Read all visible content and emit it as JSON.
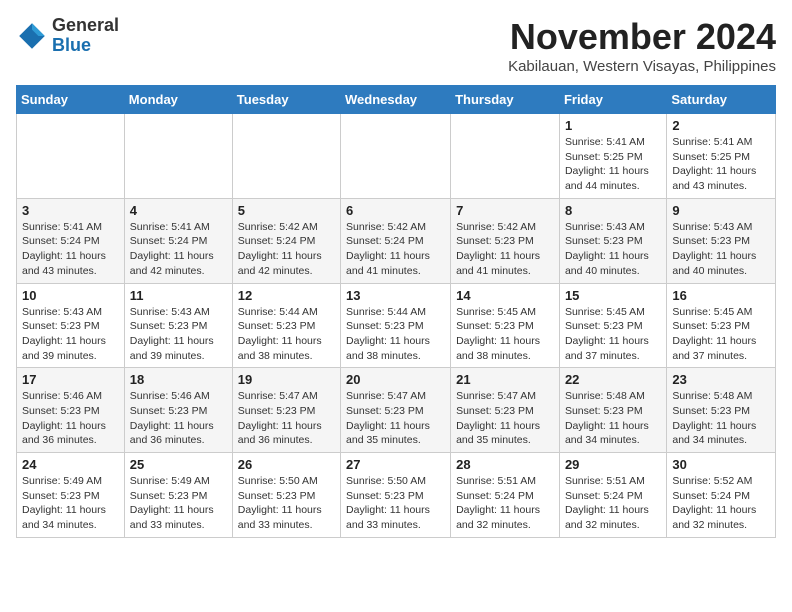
{
  "header": {
    "logo_line1": "General",
    "logo_line2": "Blue",
    "month_title": "November 2024",
    "location": "Kabilauan, Western Visayas, Philippines"
  },
  "weekdays": [
    "Sunday",
    "Monday",
    "Tuesday",
    "Wednesday",
    "Thursday",
    "Friday",
    "Saturday"
  ],
  "weeks": [
    [
      {
        "day": "",
        "info": ""
      },
      {
        "day": "",
        "info": ""
      },
      {
        "day": "",
        "info": ""
      },
      {
        "day": "",
        "info": ""
      },
      {
        "day": "",
        "info": ""
      },
      {
        "day": "1",
        "info": "Sunrise: 5:41 AM\nSunset: 5:25 PM\nDaylight: 11 hours and 44 minutes."
      },
      {
        "day": "2",
        "info": "Sunrise: 5:41 AM\nSunset: 5:25 PM\nDaylight: 11 hours and 43 minutes."
      }
    ],
    [
      {
        "day": "3",
        "info": "Sunrise: 5:41 AM\nSunset: 5:24 PM\nDaylight: 11 hours and 43 minutes."
      },
      {
        "day": "4",
        "info": "Sunrise: 5:41 AM\nSunset: 5:24 PM\nDaylight: 11 hours and 42 minutes."
      },
      {
        "day": "5",
        "info": "Sunrise: 5:42 AM\nSunset: 5:24 PM\nDaylight: 11 hours and 42 minutes."
      },
      {
        "day": "6",
        "info": "Sunrise: 5:42 AM\nSunset: 5:24 PM\nDaylight: 11 hours and 41 minutes."
      },
      {
        "day": "7",
        "info": "Sunrise: 5:42 AM\nSunset: 5:23 PM\nDaylight: 11 hours and 41 minutes."
      },
      {
        "day": "8",
        "info": "Sunrise: 5:43 AM\nSunset: 5:23 PM\nDaylight: 11 hours and 40 minutes."
      },
      {
        "day": "9",
        "info": "Sunrise: 5:43 AM\nSunset: 5:23 PM\nDaylight: 11 hours and 40 minutes."
      }
    ],
    [
      {
        "day": "10",
        "info": "Sunrise: 5:43 AM\nSunset: 5:23 PM\nDaylight: 11 hours and 39 minutes."
      },
      {
        "day": "11",
        "info": "Sunrise: 5:43 AM\nSunset: 5:23 PM\nDaylight: 11 hours and 39 minutes."
      },
      {
        "day": "12",
        "info": "Sunrise: 5:44 AM\nSunset: 5:23 PM\nDaylight: 11 hours and 38 minutes."
      },
      {
        "day": "13",
        "info": "Sunrise: 5:44 AM\nSunset: 5:23 PM\nDaylight: 11 hours and 38 minutes."
      },
      {
        "day": "14",
        "info": "Sunrise: 5:45 AM\nSunset: 5:23 PM\nDaylight: 11 hours and 38 minutes."
      },
      {
        "day": "15",
        "info": "Sunrise: 5:45 AM\nSunset: 5:23 PM\nDaylight: 11 hours and 37 minutes."
      },
      {
        "day": "16",
        "info": "Sunrise: 5:45 AM\nSunset: 5:23 PM\nDaylight: 11 hours and 37 minutes."
      }
    ],
    [
      {
        "day": "17",
        "info": "Sunrise: 5:46 AM\nSunset: 5:23 PM\nDaylight: 11 hours and 36 minutes."
      },
      {
        "day": "18",
        "info": "Sunrise: 5:46 AM\nSunset: 5:23 PM\nDaylight: 11 hours and 36 minutes."
      },
      {
        "day": "19",
        "info": "Sunrise: 5:47 AM\nSunset: 5:23 PM\nDaylight: 11 hours and 36 minutes."
      },
      {
        "day": "20",
        "info": "Sunrise: 5:47 AM\nSunset: 5:23 PM\nDaylight: 11 hours and 35 minutes."
      },
      {
        "day": "21",
        "info": "Sunrise: 5:47 AM\nSunset: 5:23 PM\nDaylight: 11 hours and 35 minutes."
      },
      {
        "day": "22",
        "info": "Sunrise: 5:48 AM\nSunset: 5:23 PM\nDaylight: 11 hours and 34 minutes."
      },
      {
        "day": "23",
        "info": "Sunrise: 5:48 AM\nSunset: 5:23 PM\nDaylight: 11 hours and 34 minutes."
      }
    ],
    [
      {
        "day": "24",
        "info": "Sunrise: 5:49 AM\nSunset: 5:23 PM\nDaylight: 11 hours and 34 minutes."
      },
      {
        "day": "25",
        "info": "Sunrise: 5:49 AM\nSunset: 5:23 PM\nDaylight: 11 hours and 33 minutes."
      },
      {
        "day": "26",
        "info": "Sunrise: 5:50 AM\nSunset: 5:23 PM\nDaylight: 11 hours and 33 minutes."
      },
      {
        "day": "27",
        "info": "Sunrise: 5:50 AM\nSunset: 5:23 PM\nDaylight: 11 hours and 33 minutes."
      },
      {
        "day": "28",
        "info": "Sunrise: 5:51 AM\nSunset: 5:24 PM\nDaylight: 11 hours and 32 minutes."
      },
      {
        "day": "29",
        "info": "Sunrise: 5:51 AM\nSunset: 5:24 PM\nDaylight: 11 hours and 32 minutes."
      },
      {
        "day": "30",
        "info": "Sunrise: 5:52 AM\nSunset: 5:24 PM\nDaylight: 11 hours and 32 minutes."
      }
    ]
  ]
}
